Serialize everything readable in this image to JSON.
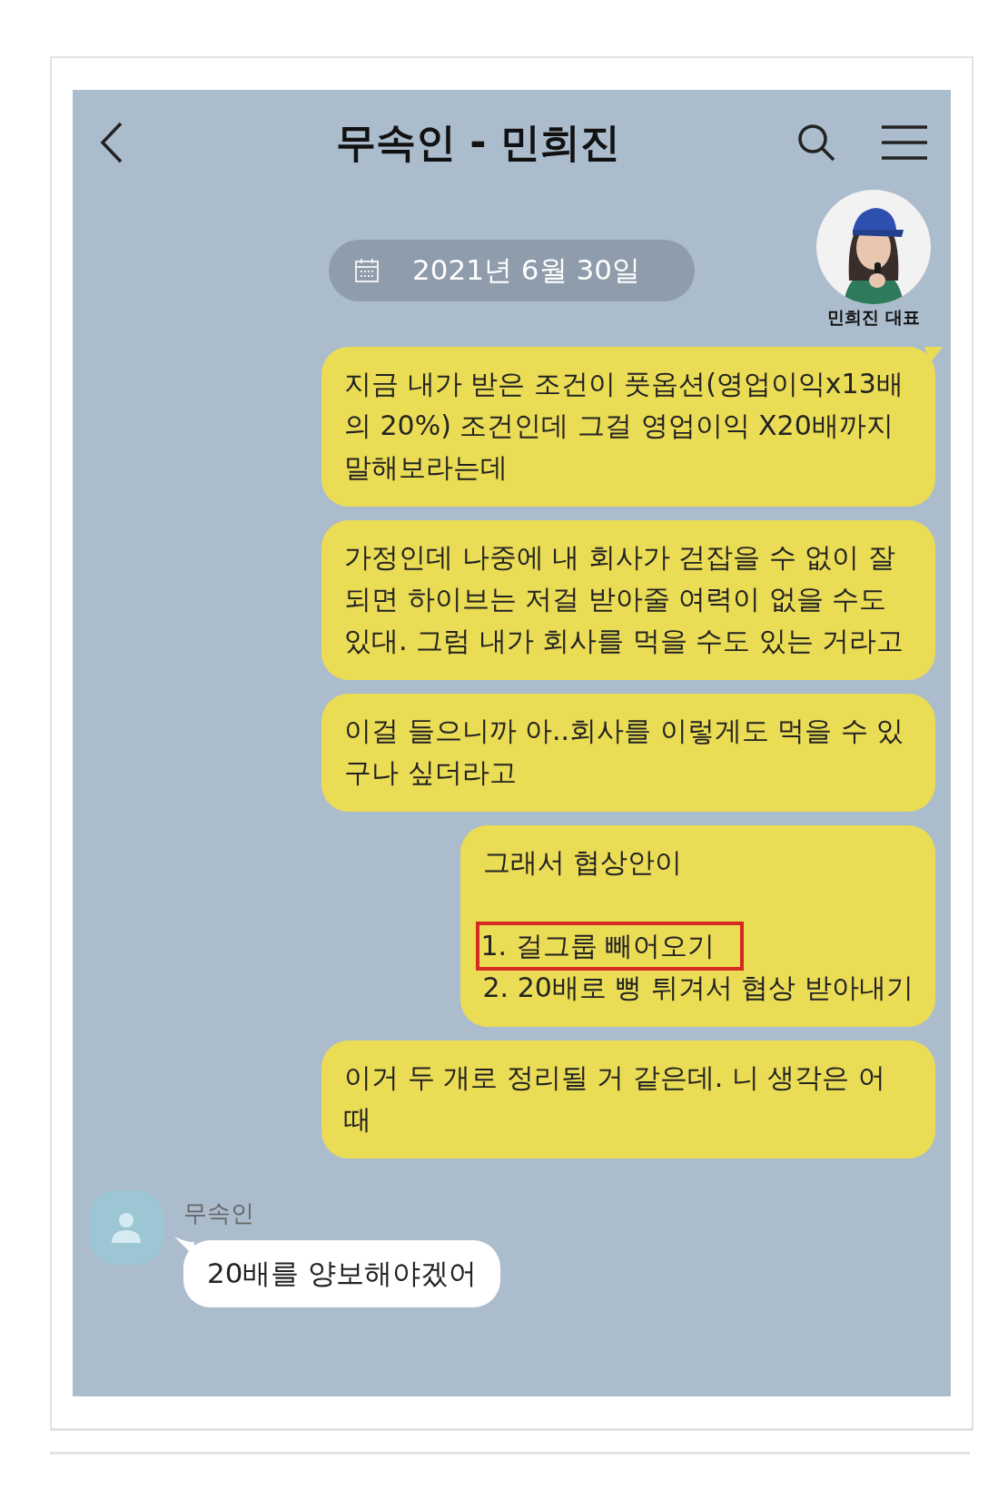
{
  "header": {
    "title": "무속인 - 민희진"
  },
  "date_divider": {
    "text": "2021년 6월 30일"
  },
  "photo_overlay": {
    "kind": "picture",
    "caption": "민희진 대표"
  },
  "messages": [
    {
      "kind": "sent",
      "text": "지금 내가 받은 조건이 풋옵션(영업이익x13배의 20%) 조건인데 그걸 영업이익 X20배까지 말해보라는데"
    },
    {
      "kind": "sent",
      "text": "가정인데 나중에 내 회사가 걷잡을 수 없이 잘 되면 하이브는 저걸 받아줄 여력이 없을 수도 있대. 그럼 내가 회사를 먹을 수도 있는 거라고"
    },
    {
      "kind": "sent",
      "text": "이걸 들으니까 아..회사를 이렇게도 먹을 수 있구나 싶더라고"
    },
    {
      "kind": "sent_list",
      "intro": "그래서 협상안이",
      "items": [
        {
          "text": "1. 걸그룹 빼어오기",
          "highlighted": true
        },
        {
          "text": "2. 20배로 뻥 튀겨서 협상 받아내기",
          "highlighted": false
        }
      ]
    },
    {
      "kind": "sent",
      "text": "이거 두 개로 정리될 거 같은데. 니 생각은 어때"
    },
    {
      "kind": "received",
      "sender": "무속인",
      "text": "20배를 양보해야겠어"
    }
  ]
}
